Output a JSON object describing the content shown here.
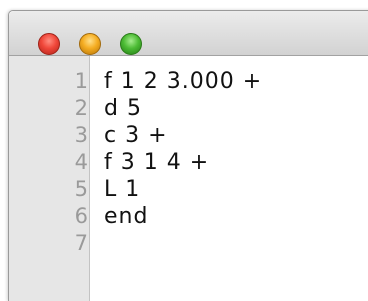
{
  "window": {
    "buttons": [
      {
        "name": "close",
        "color": "#f0473a"
      },
      {
        "name": "minimize",
        "color": "#f5ad22"
      },
      {
        "name": "zoom",
        "color": "#4dbc35"
      }
    ]
  },
  "editor": {
    "lines": [
      {
        "number": "1",
        "code": "f 1 2 3.000 +"
      },
      {
        "number": "2",
        "code": "d 5"
      },
      {
        "number": "3",
        "code": "c 3 +"
      },
      {
        "number": "4",
        "code": "f 3 1 4 +"
      },
      {
        "number": "5",
        "code": "L 1"
      },
      {
        "number": "6",
        "code": "end"
      },
      {
        "number": "7",
        "code": ""
      }
    ]
  }
}
